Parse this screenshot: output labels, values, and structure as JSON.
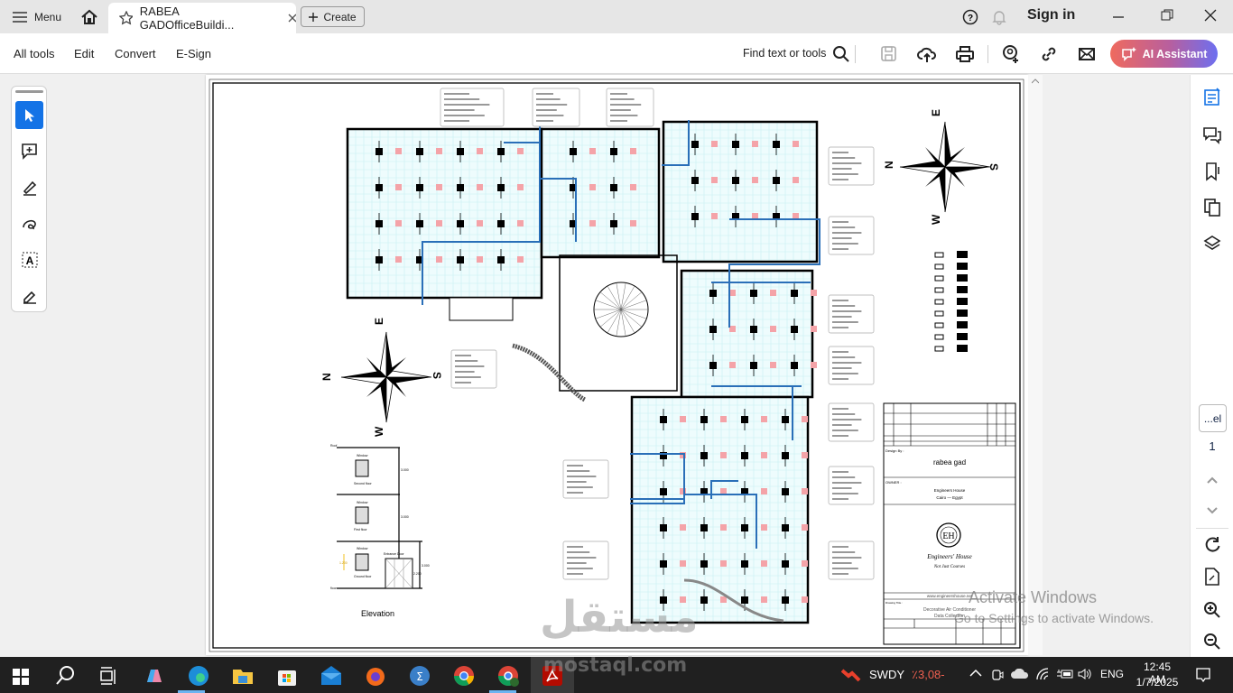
{
  "titlebar": {
    "menu_label": "Menu",
    "tab_title": "RABEA GADOfficeBuildi...",
    "create_label": "Create",
    "sign_in": "Sign in"
  },
  "toolbar": {
    "menus": [
      "All tools",
      "Edit",
      "Convert",
      "E-Sign"
    ],
    "find_label": "Find text or tools",
    "ai_label": "AI Assistant"
  },
  "colors": {
    "accent": "#1473e6",
    "duct": "#2a6fb8",
    "grid": "#c8f0f4",
    "unit_pink": "#f4a3a8",
    "ai_start": "#ef6a5e",
    "ai_end": "#6d6ff0"
  },
  "drawing": {
    "compass": {
      "n": "N",
      "e": "E",
      "s": "S",
      "w": "W"
    },
    "elevation": {
      "title": "Elevation",
      "labels": [
        "Roof",
        "Window",
        "Second floor",
        "Window",
        "First floor",
        "Window",
        "Ground floor",
        "Entrance Door",
        "floor"
      ],
      "dims": [
        "3.000",
        "3.000",
        "3.000",
        "1.200",
        "2.200"
      ]
    },
    "title_block": {
      "design_by_label": "Design By :",
      "designer": "rabea gad",
      "owner_label": "OWNER :",
      "owner_line1": "Engineers House",
      "owner_line2": "Cairo — Egypt",
      "logo_text": "Engineers' House",
      "logo_sub": "Not Just Courses",
      "website": "www.engineershouse.net",
      "drawing_title_label": "Drawing Title :",
      "drawing_title_1": "Decorative Air Conditioner",
      "drawing_title_2": "Data Collection"
    }
  },
  "rightbar": {
    "page_label": "...el",
    "page_number": "1"
  },
  "watermark": {
    "arabic": "مستقل",
    "latin": "mostaql.com"
  },
  "activation": {
    "line1": "Activate Windows",
    "line2": "Go to Settings to activate Windows."
  },
  "taskbar": {
    "stock_symbol": "SWDY",
    "stock_change": "٪3,08-",
    "lang": "ENG",
    "time": "12:45 AM",
    "date": "1/7/2025"
  }
}
